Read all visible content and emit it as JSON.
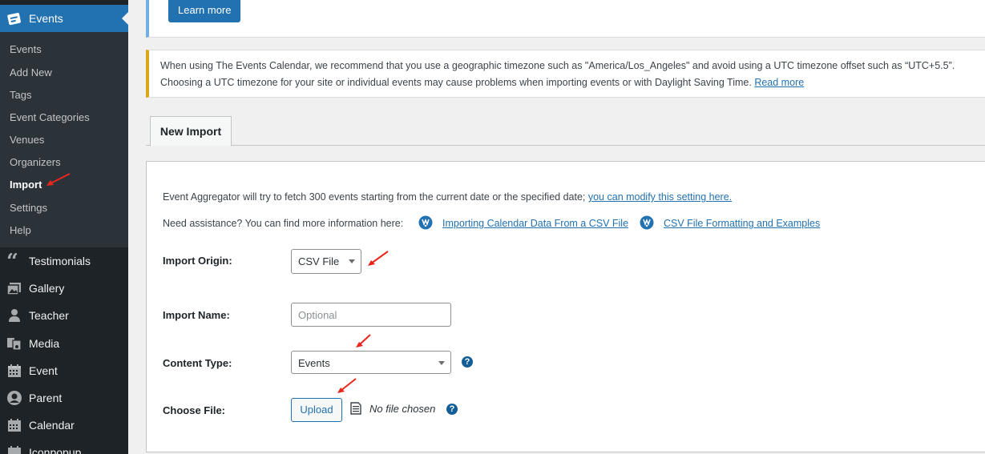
{
  "sidebar": {
    "active": {
      "label": "Events",
      "icon": "events-calendar-icon"
    },
    "submenu": [
      {
        "label": "Events"
      },
      {
        "label": "Add New"
      },
      {
        "label": "Tags"
      },
      {
        "label": "Event Categories"
      },
      {
        "label": "Venues"
      },
      {
        "label": "Organizers"
      },
      {
        "label": "Import",
        "current": true
      },
      {
        "label": "Settings"
      },
      {
        "label": "Help"
      }
    ],
    "items": [
      {
        "label": "Testimonials",
        "icon": "quote-icon"
      },
      {
        "label": "Gallery",
        "icon": "gallery-icon"
      },
      {
        "label": "Teacher",
        "icon": "person-icon"
      },
      {
        "label": "Media",
        "icon": "media-icon"
      },
      {
        "label": "Event",
        "icon": "calendar-icon"
      },
      {
        "label": "Parent",
        "icon": "user-circle-icon"
      },
      {
        "label": "Calendar",
        "icon": "calendar-icon"
      },
      {
        "label": "Iconpopup",
        "icon": "calendar-icon"
      }
    ]
  },
  "top_notice": {
    "button_label": "Learn more"
  },
  "tz_notice": {
    "line1": "When using The Events Calendar, we recommend that you use a geographic timezone such as \"America/Los_Angeles\" and avoid using a UTC timezone offset such as “UTC+5.5”.",
    "line2": "Choosing a UTC timezone for your site or individual events may cause problems when importing events or with Daylight Saving Time.",
    "link": "Read more"
  },
  "tabs": [
    {
      "label": "New Import",
      "active": true
    }
  ],
  "panel": {
    "info_text": "Event Aggregator will try to fetch 300 events starting from the current date or the specified date;",
    "info_link": "you can modify this setting here.",
    "assist_text": "Need assistance? You can find more information here:",
    "assist_links": [
      "Importing Calendar Data From a CSV File",
      "CSV File Formatting and Examples"
    ],
    "import_origin": {
      "label": "Import Origin:",
      "value": "CSV File"
    },
    "import_name": {
      "label": "Import Name:",
      "placeholder": "Optional",
      "value": ""
    },
    "content_type": {
      "label": "Content Type:",
      "value": "Events"
    },
    "choose_file": {
      "label": "Choose File:",
      "button": "Upload",
      "status": "No file chosen"
    },
    "help_glyph": "?"
  },
  "colors": {
    "accent": "#2271b1",
    "sidebar_bg": "#1d2327",
    "submenu_bg": "#2c3338",
    "warning_border": "#dba617",
    "annotation": "#e8261c"
  }
}
